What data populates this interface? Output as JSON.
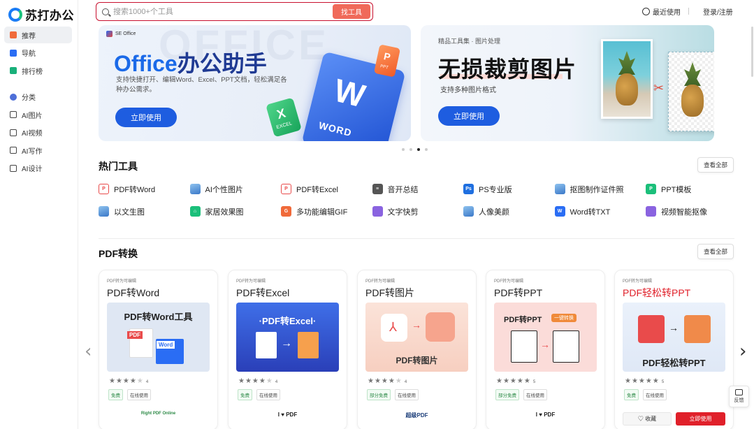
{
  "app": {
    "logo_text": "苏打办公"
  },
  "sidebar": {
    "items": [
      {
        "label": "推荐",
        "icon": "recommend-icon",
        "color": "#f06a3a"
      },
      {
        "label": "导航",
        "icon": "bookmark-icon",
        "color": "#2a6df4"
      },
      {
        "label": "排行榜",
        "icon": "chart-icon",
        "color": "#19b07a"
      },
      {
        "label": "分类",
        "icon": "category-icon",
        "color": "#4e6fd8"
      },
      {
        "label": "AI图片",
        "icon": "image-icon",
        "color": "#444444"
      },
      {
        "label": "AI视频",
        "icon": "video-icon",
        "color": "#444444"
      },
      {
        "label": "AI写作",
        "icon": "pen-icon",
        "color": "#444444"
      },
      {
        "label": "AI设计",
        "icon": "design-icon",
        "color": "#444444"
      }
    ]
  },
  "header": {
    "search_placeholder": "搜索1000+个工具",
    "search_button": "找工具",
    "recent": "最近使用",
    "login": "登录/注册"
  },
  "banners": {
    "b1": {
      "brand": "SE Office",
      "title_blue": "Office",
      "title_rest": "办公助手",
      "subtitle": "支持快捷打开、编辑Word、Excel、PPT文档，轻松满足各种办公需求。",
      "cta": "立即使用",
      "bg_word": "OFFICE"
    },
    "b2": {
      "kicker": "精品工具集 · 图片处理",
      "title": "无损裁剪图片",
      "subtitle": "支持多种图片格式",
      "cta": "立即使用"
    }
  },
  "hot_tools": {
    "title": "热门工具",
    "view_all": "查看全部",
    "items": [
      {
        "label": "PDF转Word",
        "icon": "pdf-icon",
        "color": "#e94b4b"
      },
      {
        "label": "AI个性图片",
        "icon": "image-icon",
        "color": "#3a8bd8"
      },
      {
        "label": "PDF转Excel",
        "icon": "pdf-icon",
        "color": "#e94b4b"
      },
      {
        "label": "音开总结",
        "icon": "document-icon",
        "color": "#555555"
      },
      {
        "label": "PS专业版",
        "icon": "ps-icon",
        "color": "#1f6fe0"
      },
      {
        "label": "抠图制作证件照",
        "icon": "image-icon",
        "color": "#3a8bd8"
      },
      {
        "label": "PPT模板",
        "icon": "ppt-icon",
        "color": "#1bbf7a"
      },
      {
        "label": "以文生图",
        "icon": "image-icon",
        "color": "#3a8bd8"
      },
      {
        "label": "家居效果图",
        "icon": "home-icon",
        "color": "#1bbf7a"
      },
      {
        "label": "多功能编辑GIF",
        "icon": "gif-icon",
        "color": "#f06a3a"
      },
      {
        "label": "文字快剪",
        "icon": "video-icon",
        "color": "#8a63e0"
      },
      {
        "label": "人像美颜",
        "icon": "image-icon",
        "color": "#3a8bd8"
      },
      {
        "label": "Word转TXT",
        "icon": "word-icon",
        "color": "#2a6df4"
      },
      {
        "label": "视频智能抠像",
        "icon": "video-icon",
        "color": "#8a63e0"
      }
    ]
  },
  "pdf_section": {
    "title": "PDF转换",
    "view_all": "查看全部",
    "cards": [
      {
        "kicker": "PDF转为可编辑",
        "title": "PDF转Word",
        "thumb_label": "PDF转Word工具",
        "rating": "4",
        "tags": [
          "免费",
          "在线使用"
        ],
        "brand": "Right PDF Online"
      },
      {
        "kicker": "PDF转为可编辑",
        "title": "PDF转Excel",
        "thumb_label": "·PDF转Excel·",
        "rating": "4",
        "tags": [
          "免费",
          "在线使用"
        ],
        "brand": "I ♥ PDF"
      },
      {
        "kicker": "PDF转为可编辑",
        "title": "PDF转图片",
        "thumb_label": "PDF转图片",
        "rating": "4",
        "tags": [
          "部分免费",
          "在线使用"
        ],
        "brand": "超级PDF"
      },
      {
        "kicker": "PDF转为可编辑",
        "title": "PDF转PPT",
        "thumb_label": "PDF转PPT",
        "thumb_badge": "一键转换",
        "rating": "5",
        "tags": [
          "部分免费",
          "在线使用"
        ],
        "brand": "I ♥ PDF"
      },
      {
        "kicker": "PDF转为可编辑",
        "title": "PDF轻松转PPT",
        "thumb_label": "PDF轻松转PPT",
        "rating": "5",
        "tags": [
          "免费",
          "在线使用"
        ],
        "fav": "收藏",
        "use": "立即使用"
      }
    ]
  },
  "feedback": "反馈",
  "colors": {
    "accent": "#e0202a",
    "brand_blue": "#1e5de0",
    "search_border": "#c8102e"
  }
}
